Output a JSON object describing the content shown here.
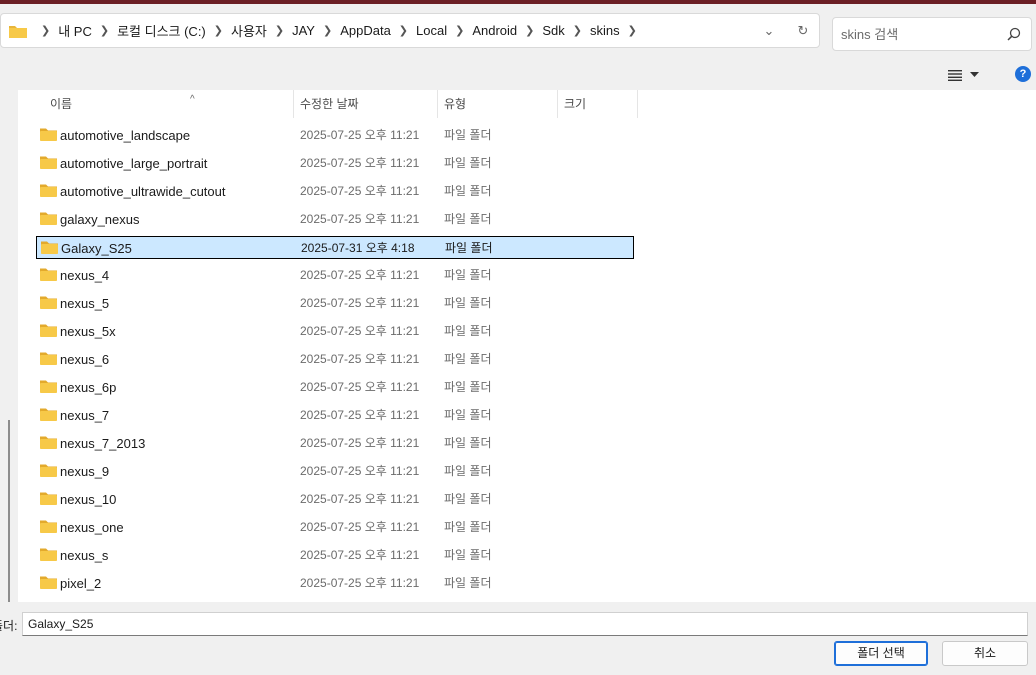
{
  "address_bar": {
    "crumbs": [
      "내 PC",
      "로컬 디스크 (C:)",
      "사용자",
      "JAY",
      "AppData",
      "Local",
      "Android",
      "Sdk",
      "skins"
    ]
  },
  "search": {
    "placeholder": "skins 검색"
  },
  "help_label": "?",
  "columns": {
    "name": "이름",
    "modified": "수정한 날짜",
    "type": "유형",
    "size": "크기"
  },
  "files": [
    {
      "name": "automotive_landscape",
      "modified": "2025-07-25 오후 11:21",
      "type": "파일 폴더"
    },
    {
      "name": "automotive_large_portrait",
      "modified": "2025-07-25 오후 11:21",
      "type": "파일 폴더"
    },
    {
      "name": "automotive_ultrawide_cutout",
      "modified": "2025-07-25 오후 11:21",
      "type": "파일 폴더"
    },
    {
      "name": "galaxy_nexus",
      "modified": "2025-07-25 오후 11:21",
      "type": "파일 폴더"
    },
    {
      "name": "Galaxy_S25",
      "modified": "2025-07-31 오후 4:18",
      "type": "파일 폴더",
      "selected": true
    },
    {
      "name": "nexus_4",
      "modified": "2025-07-25 오후 11:21",
      "type": "파일 폴더"
    },
    {
      "name": "nexus_5",
      "modified": "2025-07-25 오후 11:21",
      "type": "파일 폴더"
    },
    {
      "name": "nexus_5x",
      "modified": "2025-07-25 오후 11:21",
      "type": "파일 폴더"
    },
    {
      "name": "nexus_6",
      "modified": "2025-07-25 오후 11:21",
      "type": "파일 폴더"
    },
    {
      "name": "nexus_6p",
      "modified": "2025-07-25 오후 11:21",
      "type": "파일 폴더"
    },
    {
      "name": "nexus_7",
      "modified": "2025-07-25 오후 11:21",
      "type": "파일 폴더"
    },
    {
      "name": "nexus_7_2013",
      "modified": "2025-07-25 오후 11:21",
      "type": "파일 폴더"
    },
    {
      "name": "nexus_9",
      "modified": "2025-07-25 오후 11:21",
      "type": "파일 폴더"
    },
    {
      "name": "nexus_10",
      "modified": "2025-07-25 오후 11:21",
      "type": "파일 폴더"
    },
    {
      "name": "nexus_one",
      "modified": "2025-07-25 오후 11:21",
      "type": "파일 폴더"
    },
    {
      "name": "nexus_s",
      "modified": "2025-07-25 오후 11:21",
      "type": "파일 폴더"
    },
    {
      "name": "pixel_2",
      "modified": "2025-07-25 오후 11:21",
      "type": "파일 폴더"
    }
  ],
  "footer": {
    "folder_label": "폴더:",
    "folder_value": "Galaxy_S25",
    "select_button": "폴더 선택",
    "cancel_button": "취소"
  },
  "colors": {
    "folder": "#f7c948",
    "selection": "#cce8ff",
    "accent": "#1e6fd9"
  }
}
